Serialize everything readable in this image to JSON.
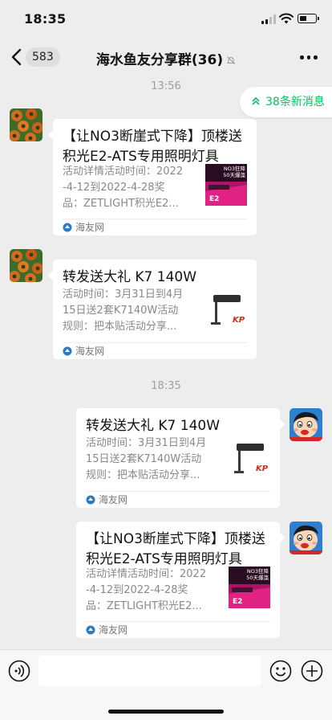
{
  "status": {
    "time": "18:35"
  },
  "nav": {
    "back_count": "583",
    "title": "海水鱼友分享群(36)"
  },
  "new_messages": {
    "label": "38条新消息"
  },
  "timestamps": [
    "13:56",
    "18:35"
  ],
  "messages": [
    {
      "title": "【让NO3断崖式下降】顶楼送积光E2-ATS专用照明灯具",
      "desc": [
        "活动详情活动时间：2022",
        "-4-12到2022-4-28奖",
        "品：ZETLIGHT积光E2..."
      ],
      "source": "海友网"
    },
    {
      "title": "转发送大礼 K7 140W",
      "desc": [
        "活动时间：3月31日到4月",
        "15日送2套K7140W活动",
        "规则：把本贴活动分享..."
      ],
      "source": "海友网"
    },
    {
      "title": "转发送大礼 K7 140W",
      "desc": [
        "活动时间：3月31日到4月",
        "15日送2套K7140W活动",
        "规则：把本贴活动分享..."
      ],
      "source": "海友网"
    },
    {
      "title": "【让NO3断崖式下降】顶楼送积光E2-ATS专用照明灯具",
      "desc": [
        "活动详情活动时间：2022",
        "-4-12到2022-4-28奖",
        "品：ZETLIGHT积光E2..."
      ],
      "source": "海友网"
    }
  ],
  "thumb_text": {
    "e2_headline": "NO3狂降",
    "e2_sub": "50天爆藻",
    "e2_model": "E2",
    "kp": "KP"
  },
  "colors": {
    "accent": "#07c160",
    "background": "#ededed",
    "bubble": "#ffffff"
  }
}
